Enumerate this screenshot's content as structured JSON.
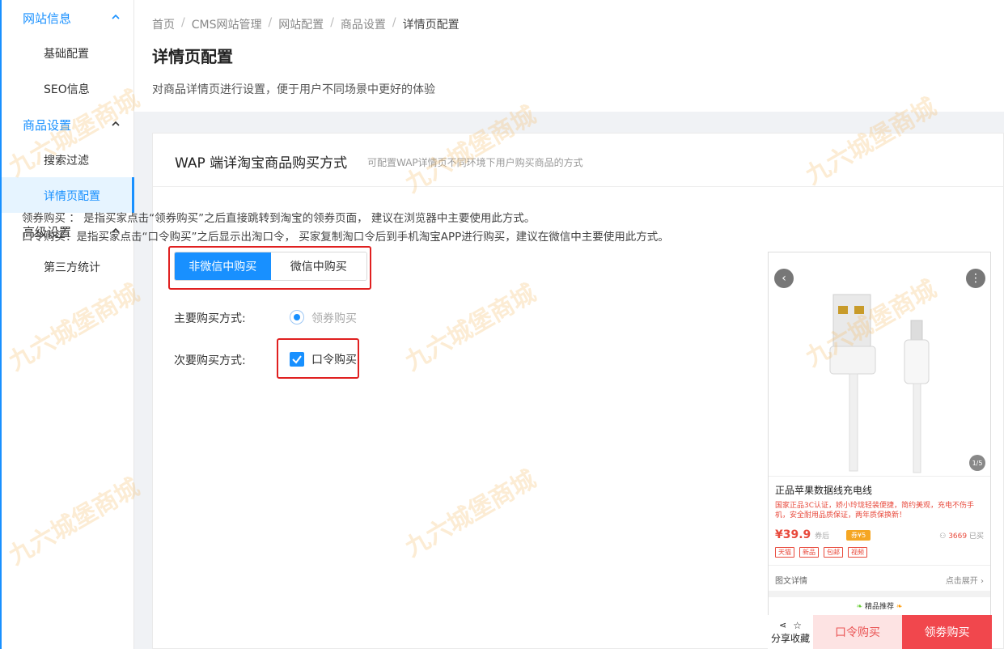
{
  "sidebar": {
    "groups": [
      {
        "label": "网站信息",
        "items": [
          "基础配置",
          "SEO信息"
        ]
      },
      {
        "label": "商品设置",
        "items": [
          "搜索过滤",
          "详情页配置"
        ]
      },
      {
        "label": "高级设置",
        "items": [
          "第三方统计"
        ]
      }
    ],
    "active_item": "详情页配置",
    "accent_color": "#1890ff"
  },
  "breadcrumb": [
    "首页",
    "CMS网站管理",
    "网站配置",
    "商品设置",
    "详情页配置"
  ],
  "breadcrumb_sep": "/",
  "page": {
    "title": "详情页配置",
    "description": "对商品详情页进行设置，便于用户不同场景中更好的体验"
  },
  "card": {
    "title": "WAP 端详淘宝商品购买方式",
    "subtitle": "可配置WAP详情页不同环境下用户购买商品的方式",
    "desc1": "领券购买 ： 是指买家点击“领券购买”之后直接跳转到淘宝的领券页面， 建议在浏览器中主要使用此方式。",
    "desc2": "口令购买：是指买家点击“口令购买”之后显示出淘口令， 买家复制淘口令后到手机淘宝APP进行购买，建议在微信中主要使用此方式。",
    "tabs": [
      "非微信中购买",
      "微信中购买"
    ],
    "active_tab": "非微信中购买",
    "primary_label": "主要购买方式:",
    "primary_value": "领券购买",
    "secondary_label": "次要购买方式:",
    "secondary_value": "口令购买",
    "secondary_checked": true
  },
  "preview": {
    "pager": "1/5",
    "product_title": "正品苹果数据线充电线",
    "product_desc": "国家正品3C认证，娇小玲珑轻装便捷，简约美观，充电不伤手机，安全耐用品质保证，两年质保换新！",
    "price": "¥39.9",
    "price_suffix": "券后",
    "vip_badge": "券¥5",
    "sold_count": "3669",
    "sold_suffix": "已买",
    "tags": [
      "天猫",
      "新品",
      "包邮",
      "视频"
    ],
    "detail_label": "图文详情",
    "detail_expand": "点击展开",
    "recommend": "精品推荐",
    "share_fav": "分享收藏",
    "btn_kouling": "口令购买",
    "btn_lingquan": "领劵购买"
  },
  "watermark": "九六城堡商城"
}
